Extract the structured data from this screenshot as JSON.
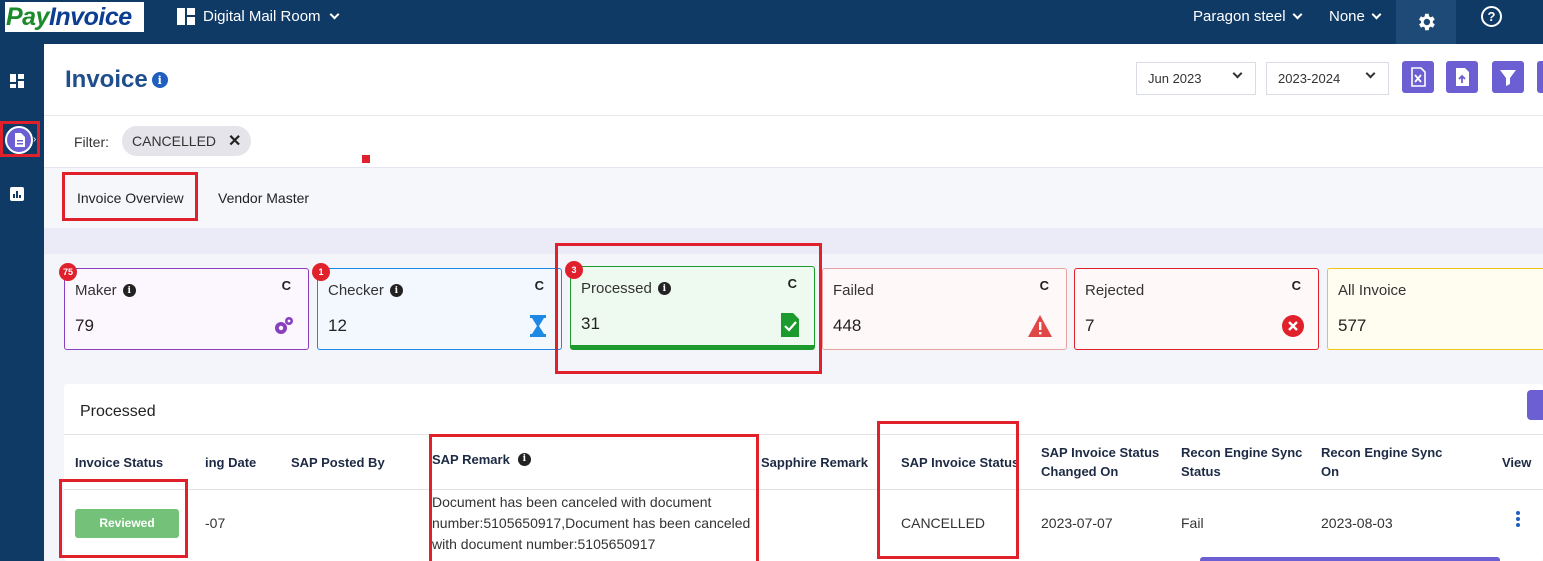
{
  "topbar": {
    "logo_part1": "Pay",
    "logo_part2": "Invoice",
    "app_name": "Digital Mail Room",
    "company": "Paragon steel",
    "filter_menu": "None",
    "help_glyph": "?"
  },
  "header": {
    "title": "Invoice",
    "info_glyph": "i",
    "month_select": "Jun 2023",
    "year_select": "2023-2024",
    "colors": {
      "accent": "#6b5fd3",
      "navy": "#0f3a66",
      "title": "#1f4e8c"
    }
  },
  "filter": {
    "label": "Filter:",
    "chip": "CANCELLED",
    "chip_close": "✕"
  },
  "tabs": [
    {
      "label": "Invoice Overview"
    },
    {
      "label": "Vendor Master"
    }
  ],
  "cards": [
    {
      "label": "Maker",
      "count": "79",
      "badge": "75",
      "icon": "gears-icon",
      "color": "#8a3fbf"
    },
    {
      "label": "Checker",
      "count": "12",
      "badge": "1",
      "icon": "hourglass-icon",
      "color": "#1e88e5"
    },
    {
      "label": "Processed",
      "count": "31",
      "badge": "3",
      "icon": "file-check-icon",
      "color": "#1c9a2e"
    },
    {
      "label": "Failed",
      "count": "448",
      "icon": "warning-icon",
      "color": "#e04848"
    },
    {
      "label": "Rejected",
      "count": "7",
      "icon": "error-circle-icon",
      "color": "#e0212b"
    },
    {
      "label": "All Invoice",
      "count": "577",
      "icon": "hourglass-icon",
      "color": "#f2c417"
    }
  ],
  "card_refresh": "C",
  "table": {
    "title": "Processed",
    "headers": {
      "invoice_status": "Invoice Status",
      "posting_date": "ing Date",
      "sap_posted_by": "SAP Posted By",
      "sap_remark": "SAP Remark",
      "sapphire_remark": "Sapphire Remark",
      "sap_invoice_status": "SAP Invoice Status",
      "sap_status_changed_1": "SAP Invoice Status",
      "sap_status_changed_2": "Changed On",
      "recon_status_1": "Recon Engine Sync",
      "recon_status_2": "Status",
      "recon_on_1": "Recon Engine Sync",
      "recon_on_2": "On",
      "view": "View"
    },
    "rows": [
      {
        "invoice_status": "Reviewed",
        "posting_date": "-07",
        "sap_remark_line1": "Document has been canceled with document",
        "sap_remark_line2": "number:5105650917,Document has been canceled",
        "sap_remark_line3": "with document number:5105650917",
        "sap_invoice_status": "CANCELLED",
        "sap_status_changed_on": "2023-07-07",
        "recon_status": "Fail",
        "recon_on": "2023-08-03"
      }
    ]
  }
}
